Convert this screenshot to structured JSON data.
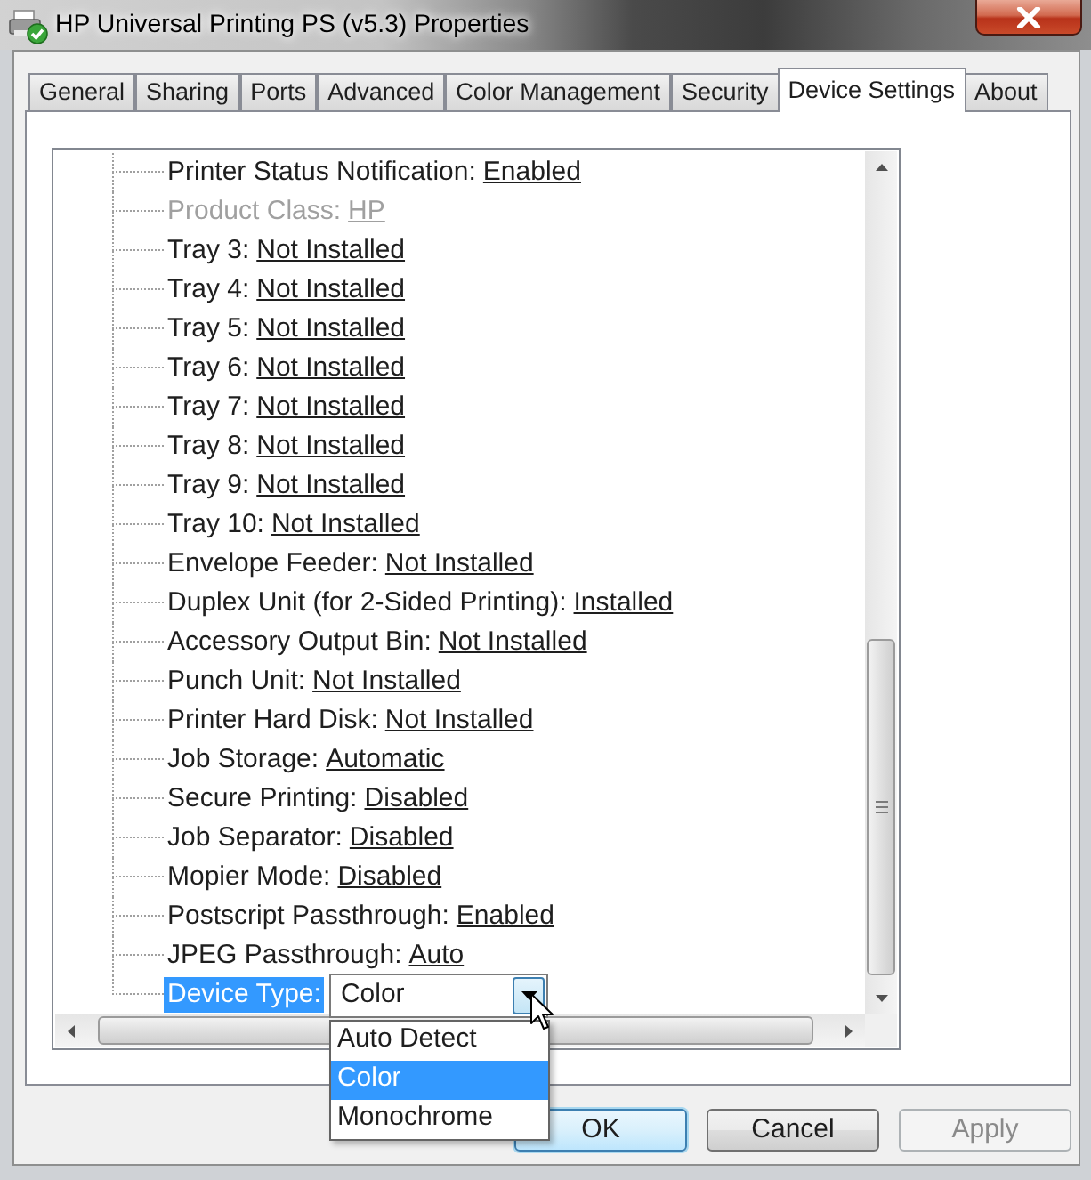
{
  "window": {
    "title": "HP Universal Printing PS (v5.3) Properties"
  },
  "tabs": [
    {
      "label": "General",
      "selected": false
    },
    {
      "label": "Sharing",
      "selected": false
    },
    {
      "label": "Ports",
      "selected": false
    },
    {
      "label": "Advanced",
      "selected": false
    },
    {
      "label": "Color Management",
      "selected": false
    },
    {
      "label": "Security",
      "selected": false
    },
    {
      "label": "Device Settings",
      "selected": true
    },
    {
      "label": "About",
      "selected": false
    }
  ],
  "tree": {
    "items": [
      {
        "kind": "setting",
        "label": "Printer Status Notification:",
        "value": "Enabled",
        "selected": false,
        "disabled": false
      },
      {
        "kind": "setting",
        "label": "Product Class:",
        "value": "HP",
        "selected": false,
        "disabled": true
      },
      {
        "kind": "setting",
        "label": "Tray 3:",
        "value": "Not Installed",
        "selected": false,
        "disabled": false
      },
      {
        "kind": "setting",
        "label": "Tray 4:",
        "value": "Not Installed",
        "selected": false,
        "disabled": false
      },
      {
        "kind": "setting",
        "label": "Tray 5:",
        "value": "Not Installed",
        "selected": false,
        "disabled": false
      },
      {
        "kind": "setting",
        "label": "Tray 6:",
        "value": "Not Installed",
        "selected": false,
        "disabled": false
      },
      {
        "kind": "setting",
        "label": "Tray 7:",
        "value": "Not Installed",
        "selected": false,
        "disabled": false
      },
      {
        "kind": "setting",
        "label": "Tray 8:",
        "value": "Not Installed",
        "selected": false,
        "disabled": false
      },
      {
        "kind": "setting",
        "label": "Tray 9:",
        "value": "Not Installed",
        "selected": false,
        "disabled": false
      },
      {
        "kind": "setting",
        "label": "Tray 10:",
        "value": "Not Installed",
        "selected": false,
        "disabled": false
      },
      {
        "kind": "setting",
        "label": "Envelope Feeder:",
        "value": "Not Installed",
        "selected": false,
        "disabled": false
      },
      {
        "kind": "setting",
        "label": "Duplex Unit (for 2-Sided Printing):",
        "value": "Installed",
        "selected": false,
        "disabled": false
      },
      {
        "kind": "setting",
        "label": "Accessory Output Bin:",
        "value": "Not Installed",
        "selected": false,
        "disabled": false
      },
      {
        "kind": "setting",
        "label": "Punch Unit:",
        "value": "Not Installed",
        "selected": false,
        "disabled": false
      },
      {
        "kind": "setting",
        "label": "Printer Hard Disk:",
        "value": "Not Installed",
        "selected": false,
        "disabled": false
      },
      {
        "kind": "setting",
        "label": "Job Storage:",
        "value": "Automatic",
        "selected": false,
        "disabled": false
      },
      {
        "kind": "setting",
        "label": "Secure Printing:",
        "value": "Disabled",
        "selected": false,
        "disabled": false
      },
      {
        "kind": "setting",
        "label": "Job Separator:",
        "value": "Disabled",
        "selected": false,
        "disabled": false
      },
      {
        "kind": "setting",
        "label": "Mopier Mode:",
        "value": "Disabled",
        "selected": false,
        "disabled": false
      },
      {
        "kind": "setting",
        "label": "Postscript Passthrough:",
        "value": "Enabled",
        "selected": false,
        "disabled": false
      },
      {
        "kind": "setting",
        "label": "JPEG Passthrough:",
        "value": "Auto",
        "selected": false,
        "disabled": false
      },
      {
        "kind": "combo",
        "label": "Device Type:",
        "value": "Color",
        "selected": true,
        "disabled": false,
        "expanded": true,
        "options": [
          {
            "label": "Auto Detect",
            "selected": false
          },
          {
            "label": "Color",
            "selected": true
          },
          {
            "label": "Monochrome",
            "selected": false
          }
        ]
      }
    ]
  },
  "buttons": [
    {
      "label": "OK",
      "default": true,
      "disabled": false
    },
    {
      "label": "Cancel",
      "default": false,
      "disabled": false
    },
    {
      "label": "Apply",
      "default": false,
      "disabled": true
    }
  ]
}
